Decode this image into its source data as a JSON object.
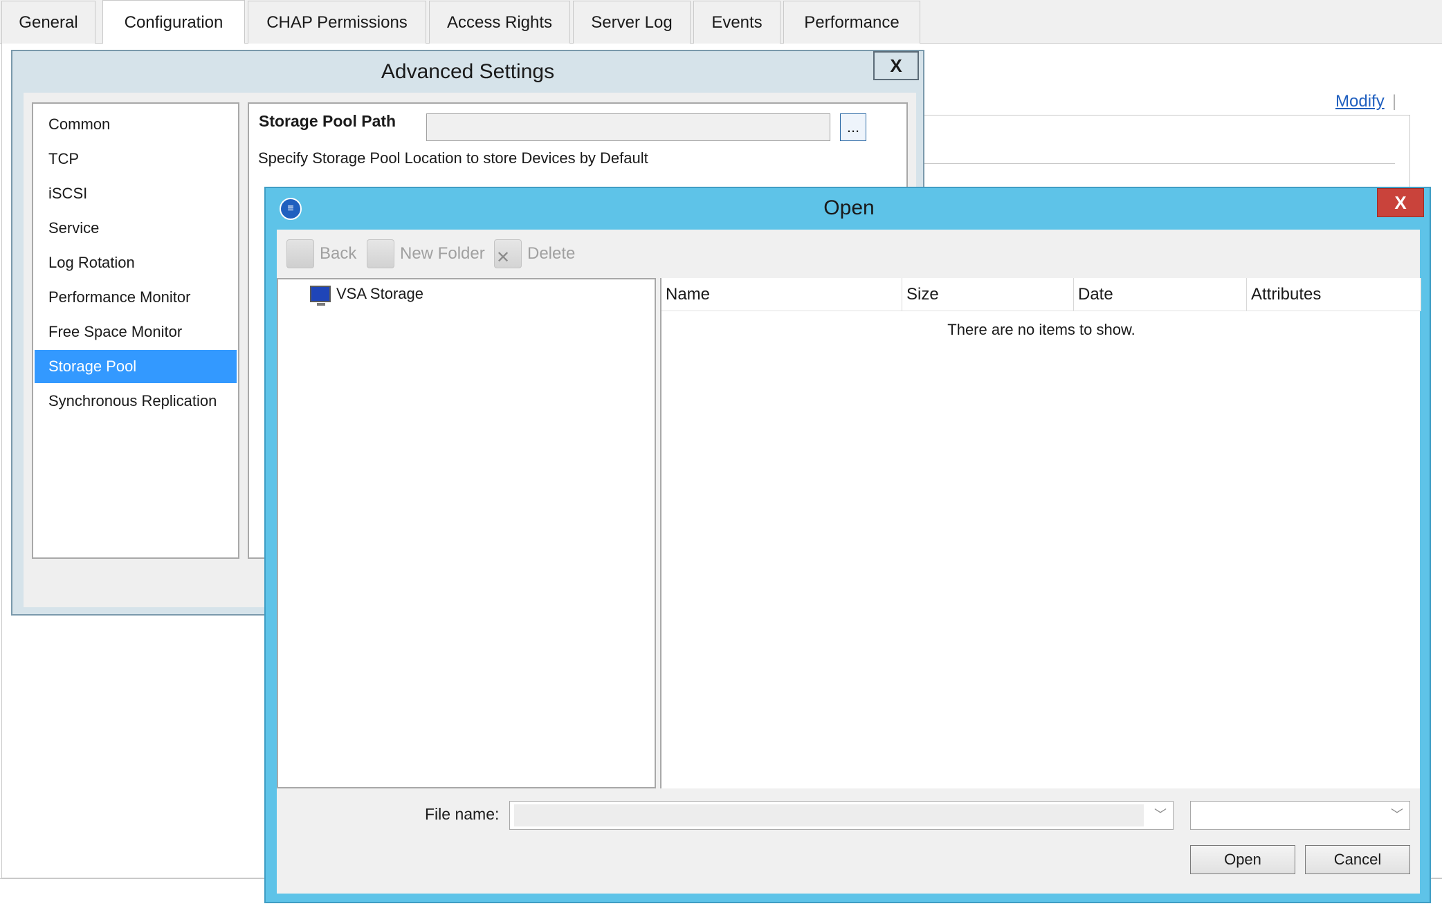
{
  "tabs": [
    {
      "label": "General"
    },
    {
      "label": "Configuration"
    },
    {
      "label": "CHAP Permissions"
    },
    {
      "label": "Access Rights"
    },
    {
      "label": "Server Log"
    },
    {
      "label": "Events"
    },
    {
      "label": "Performance"
    }
  ],
  "active_tab": "Configuration",
  "main": {
    "modify_link": "Modify",
    "modify_separator": "|"
  },
  "advanced_settings": {
    "title": "Advanced Settings",
    "close_label": "X",
    "categories": [
      "Common",
      "TCP",
      "iSCSI",
      "Service",
      "Log Rotation",
      "Performance Monitor",
      "Free Space Monitor",
      "Storage Pool",
      "Synchronous Replication"
    ],
    "selected_category": "Storage Pool",
    "storage_pool": {
      "label": "Storage Pool Path",
      "path_value": "",
      "browse_label": "...",
      "description": "Specify Storage Pool Location to store Devices by Default"
    }
  },
  "open_dialog": {
    "title": "Open",
    "close_label": "X",
    "toolbar": {
      "back": "Back",
      "new_folder": "New Folder",
      "delete": "Delete"
    },
    "tree": [
      {
        "label": "VSA Storage"
      }
    ],
    "columns": [
      "Name",
      "Size",
      "Date",
      "Attributes"
    ],
    "empty_message": "There are no items to show.",
    "file_name_label": "File name:",
    "file_name_value": "",
    "file_type_value": "",
    "open_button": "Open",
    "cancel_button": "Cancel"
  },
  "colors": {
    "selection": "#3399ff",
    "open_titlebar": "#5ec3e8",
    "close_button": "#c9433b",
    "link": "#1f5fbf"
  }
}
